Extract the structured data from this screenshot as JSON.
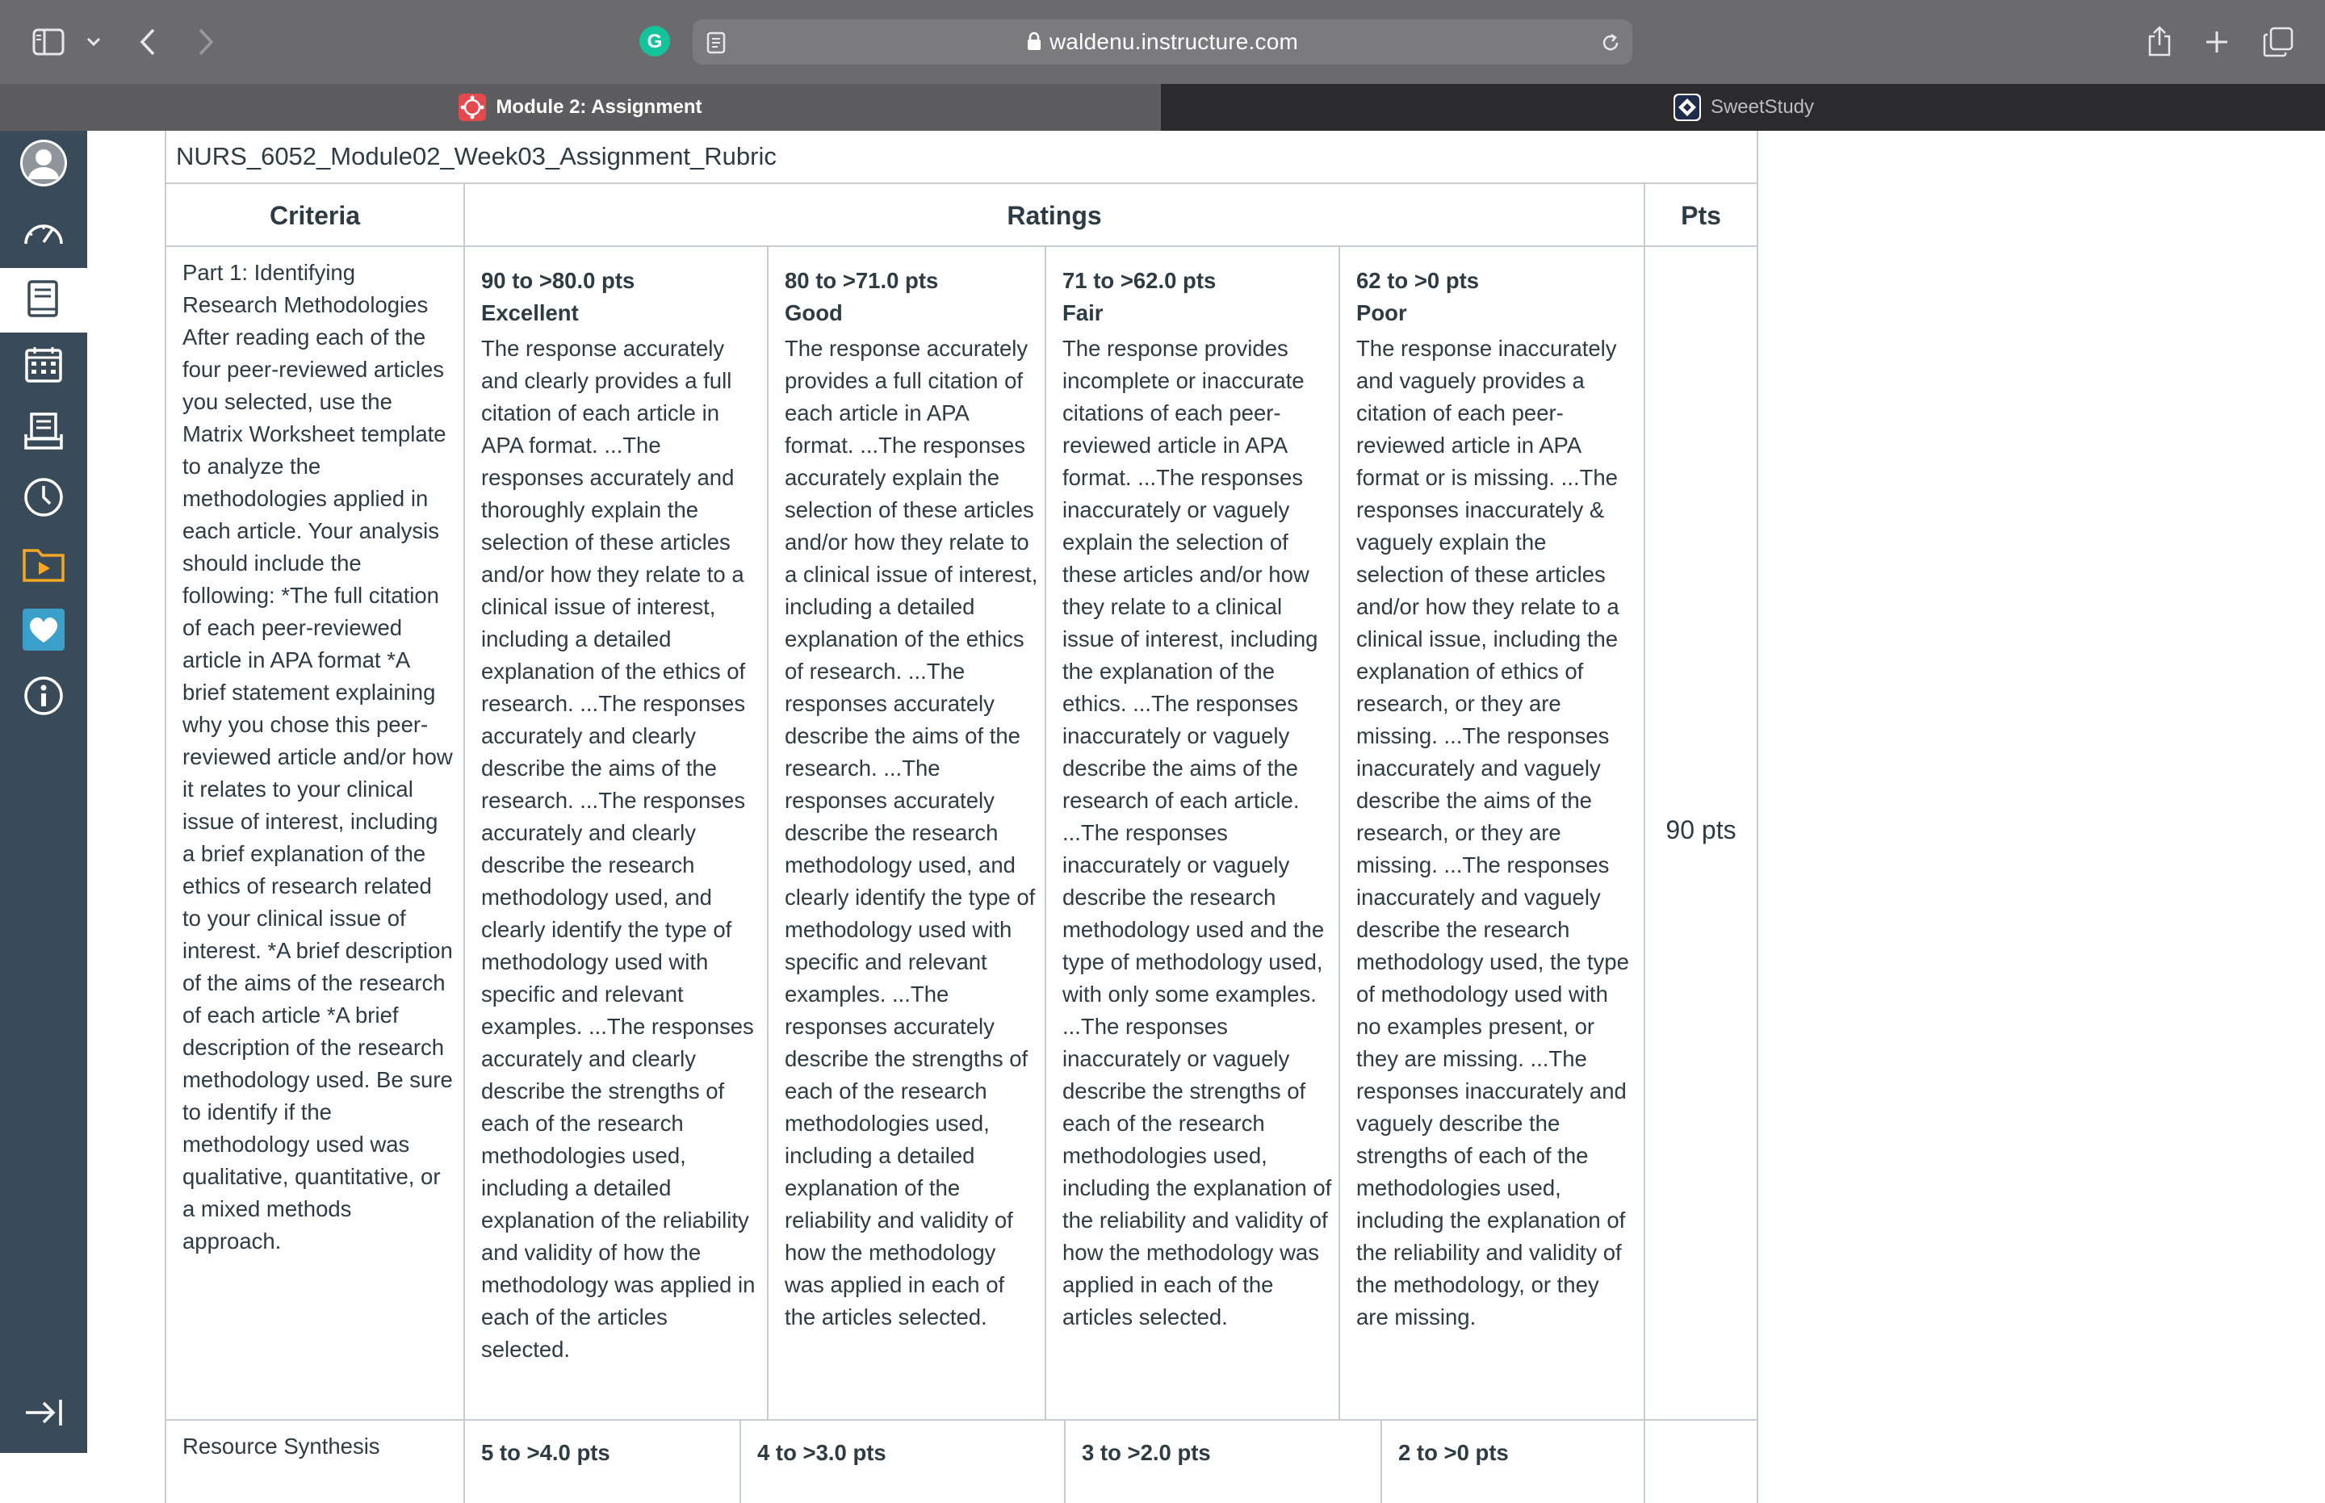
{
  "browser": {
    "url": "waldenu.instructure.com",
    "tabs": [
      {
        "title": "Module 2: Assignment"
      },
      {
        "title": "SweetStudy"
      }
    ]
  },
  "rubric": {
    "title": "NURS_6052_Module02_Week03_Assignment_Rubric",
    "headers": {
      "criteria": "Criteria",
      "ratings": "Ratings",
      "pts": "Pts"
    },
    "row1": {
      "criterion": "Part 1: Identifying Research Methodologies After reading each of the four peer-reviewed articles you selected, use the Matrix Worksheet template to analyze the methodologies applied in each article. Your analysis should include the following: *The full citation of each peer-reviewed article in APA format *A brief statement explaining why you chose this peer-reviewed article and/or how it relates to your clinical issue of interest, including a brief explanation of the ethics of research related to your clinical issue of interest. *A brief description of the aims of the research of each article *A brief description of the research methodology used. Be sure to identify if the methodology used was qualitative, quantitative, or a mixed methods approach.",
      "ratings": [
        {
          "points": "90 to >80.0 pts",
          "label": "Excellent",
          "description": "The response accurately and clearly provides a full citation of each article in APA format. ...The responses accurately and thoroughly explain the selection of these articles and/or how they relate to a clinical issue of interest, including a detailed explanation of the ethics of research. ...The responses accurately and clearly describe the aims of the research. ...The responses accurately and clearly describe the research methodology used, and clearly identify the type of methodology used with specific and relevant examples. ...The responses accurately and clearly describe the strengths of each of the research methodologies used, including a detailed explanation of the reliability and validity of how the methodology was applied in each of the articles selected."
        },
        {
          "points": "80 to >71.0 pts",
          "label": "Good",
          "description": "The response accurately provides a full citation of each article in APA format. ...The responses accurately explain the selection of these articles and/or how they relate to a clinical issue of interest, including a detailed explanation of the ethics of research. ...The responses accurately describe the aims of the research. ...The responses accurately describe the research methodology used, and clearly identify the type of methodology used with specific and relevant examples. ...The responses accurately describe the strengths of each of the research methodologies used, including a detailed explanation of the reliability and validity of how the methodology was applied in each of the articles selected."
        },
        {
          "points": "71 to >62.0 pts",
          "label": "Fair",
          "description": "The response provides incomplete or inaccurate citations of each peer-reviewed article in APA format. ...The responses inaccurately or vaguely explain the selection of these articles and/or how they relate to a clinical issue of interest, including the explanation of the ethics. ...The responses inaccurately or vaguely describe the aims of the research of each article. ...The responses inaccurately or vaguely describe the research methodology used and the type of methodology used, with only some examples. ...The responses inaccurately or vaguely describe the strengths of each of the research methodologies used, including the explanation of the reliability and validity of how the methodology was applied in each of the articles selected."
        },
        {
          "points": "62 to >0 pts",
          "label": "Poor",
          "description": "The response inaccurately and vaguely provides a citation of each peer-reviewed article in APA format or is missing. ...The responses inaccurately & vaguely explain the selection of these articles and/or how they relate to a clinical issue, including the explanation of ethics of research, or they are missing. ...The responses inaccurately and vaguely describe the aims of the research, or they are missing. ...The responses inaccurately and vaguely describe the research methodology used, the type of methodology used with no examples present, or they are missing. ...The responses inaccurately and vaguely describe the strengths of each of the methodologies used, including the explanation of the reliability and validity of the methodology, or they are missing."
        }
      ],
      "pts": "90 pts"
    },
    "row2": {
      "criterion": "Resource Synthesis",
      "ratings": [
        {
          "points": "5 to >4.0 pts"
        },
        {
          "points": "4 to >3.0 pts"
        },
        {
          "points": "3 to >2.0 pts"
        },
        {
          "points": "2 to >0 pts"
        }
      ]
    }
  },
  "icons": {
    "sidebar_toggle": "sidebar-icon",
    "back": "chevron-left-icon",
    "forward": "chevron-right-icon",
    "grammarly": "grammarly-icon",
    "reader": "reader-icon",
    "lock": "lock-icon",
    "reload": "reload-icon",
    "share": "share-icon",
    "new_tab": "plus-icon",
    "tab_overview": "tabs-icon"
  },
  "colors": {
    "canvas_nav": "#394b58",
    "text": "#2d3b45",
    "border": "#c7cdd1"
  }
}
